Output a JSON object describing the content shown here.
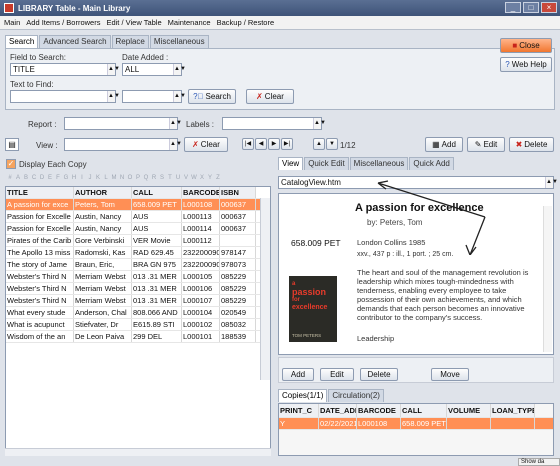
{
  "window": {
    "title": "LIBRARY Table - Main Library",
    "min": "_",
    "max": "□",
    "close": "×"
  },
  "menu": [
    "Main",
    "Add Items / Borrowers",
    "Edit / View Table",
    "Maintenance",
    "Backup / Restore"
  ],
  "search_tabs": [
    "Search",
    "Advanced Search",
    "Replace",
    "Miscellaneous"
  ],
  "search": {
    "field_label": "Field to Search:",
    "field_value": "TITLE",
    "date_label": "Date Added :",
    "date_value": "ALL",
    "find_label": "Text to Find:",
    "find_value": "",
    "search_btn": "Search",
    "clear_btn": "Clear",
    "close_btn": "Close",
    "webhelp_btn": "Web Help"
  },
  "report": {
    "report_label": "Report :",
    "labels_label": "Labels :"
  },
  "toolbar": {
    "view_label": "View :",
    "clear_btn": "Clear",
    "page": "1/12",
    "add_btn": "Add",
    "edit_btn": "Edit",
    "delete_btn": "Delete"
  },
  "display_each_copy": "Display Each Copy",
  "letters": [
    "#",
    "A",
    "B",
    "C",
    "D",
    "E",
    "F",
    "G",
    "H",
    "I",
    "J",
    "K",
    "L",
    "M",
    "N",
    "O",
    "P",
    "Q",
    "R",
    "S",
    "T",
    "U",
    "V",
    "W",
    "X",
    "Y",
    "Z"
  ],
  "table": {
    "headers": [
      "TITLE",
      "AUTHOR",
      "CALL",
      "BARCODE",
      "ISBN"
    ],
    "rows": [
      [
        "A passion for exce",
        "Peters, Tom",
        "658.009 PET",
        "L000108",
        "000637"
      ],
      [
        "Passion for Excelle",
        "Austin, Nancy",
        "AUS",
        "L000113",
        "000637"
      ],
      [
        "Passion for Excelle",
        "Austin, Nancy",
        "AUS",
        "L000114",
        "000637"
      ],
      [
        "Pirates of the Carib",
        "Gore Verbinski",
        "VER Movie",
        "L000112",
        ""
      ],
      [
        "The Apollo 13 miss",
        "Radomski, Kas",
        "RAD 629.45",
        "232200090",
        "978147"
      ],
      [
        "The story of Jame",
        "Braun, Eric,",
        "BRA GN 975",
        "232200090",
        "978073"
      ],
      [
        "Webster's Third N",
        "Merriam Webst",
        "013 .31 MER",
        "L000105",
        "085229"
      ],
      [
        "Webster's Third N",
        "Merriam Webst",
        "013 .31 MER",
        "L000106",
        "085229"
      ],
      [
        "Webster's Third N",
        "Merriam Webst",
        "013 .31 MER",
        "L000107",
        "085229"
      ],
      [
        "What every stude",
        "Anderson, Chal",
        "808.066 AND",
        "L000104",
        "020549"
      ],
      [
        "What is acupunct",
        "Stiefvater, Dr",
        "E615.89 STI",
        "L000102",
        "085032"
      ],
      [
        "Wisdom of the an",
        "De Leon Paiva",
        "299 DEL",
        "L000101",
        "188539"
      ]
    ]
  },
  "view_tabs": [
    "View",
    "Quick Edit",
    "Miscellaneous",
    "Quick Add"
  ],
  "view_file": "CatalogView.htm",
  "record": {
    "title": "A passion for excellence",
    "by": "by:   Peters, Tom",
    "call": "658.009 PET",
    "pub": "London   Collins   1985",
    "desc": "xxv., 437 p   : ill., 1 port. ; 25 cm.",
    "summary": "The heart and soul of the management revolution is leadership which mixes tough-mindedness with tenderness, enabling every employee to take possession of their own achievements, and which demands that each person becomes an innovative contributor to the company's success.",
    "subject": "Leadership",
    "cover_line1": "a",
    "cover_line2": "passion",
    "cover_line3": "for",
    "cover_line4": "excellence",
    "cover_author": "TOM PETERS"
  },
  "copy_buttons": [
    "Add",
    "Edit",
    "Delete",
    "Move"
  ],
  "copy_tabs": [
    "Copies(1/1)",
    "Circulation(2)"
  ],
  "copies": {
    "headers": [
      "PRINT_C",
      "DATE_ADDI",
      "BARCODE",
      "CALL",
      "VOLUME",
      "LOAN_TYPE"
    ],
    "row": [
      "Y",
      "02/22/2021",
      "L000108",
      "658.009 PET",
      "",
      ""
    ]
  },
  "status": "Show da",
  "colors": {
    "accent": "#ff8f55",
    "title_bar": "#3e5378"
  }
}
